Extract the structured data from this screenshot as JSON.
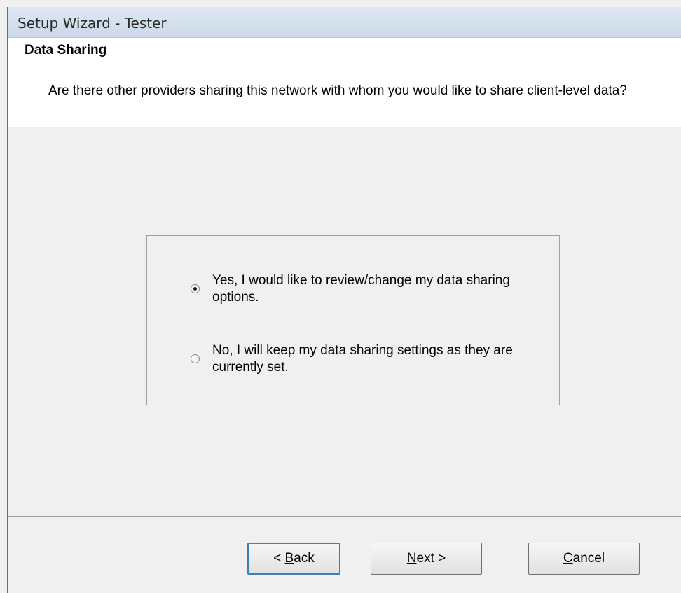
{
  "window": {
    "title": "Setup Wizard - Tester"
  },
  "header": {
    "title": "Data Sharing",
    "description": "Are there other providers sharing this network with whom you would like to share client-level data?"
  },
  "options": [
    {
      "label": "Yes, I would like to review/change my data sharing options.",
      "checked": true
    },
    {
      "label": "No, I will keep my data sharing settings as they are currently set.",
      "checked": false
    }
  ],
  "buttons": {
    "back_prefix": "< ",
    "back_mnemonic": "B",
    "back_rest": "ack",
    "next_mnemonic": "N",
    "next_rest": "ext >",
    "cancel_mnemonic": "C",
    "cancel_rest": "ancel"
  }
}
